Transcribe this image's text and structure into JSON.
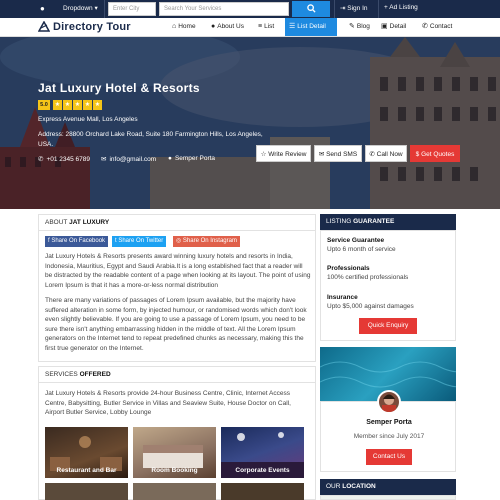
{
  "topbar": {
    "dropdown_label": "Dropdown",
    "city_placeholder": "Enter City",
    "search_placeholder": "Search Your Services",
    "sign_in": "Sign In",
    "ad_listing": "Ad Listing"
  },
  "nav": {
    "logo": "Directory Tour",
    "items": [
      {
        "icon": "home-icon",
        "label": "Home"
      },
      {
        "icon": "user-icon",
        "label": "About Us"
      },
      {
        "icon": "list-icon",
        "label": "List"
      },
      {
        "icon": "list-detail-icon",
        "label": "List Detail"
      },
      {
        "icon": "blog-icon",
        "label": "Blog"
      },
      {
        "icon": "detail-icon",
        "label": "Detail"
      },
      {
        "icon": "phone-icon",
        "label": "Contact"
      }
    ],
    "active_index": 3
  },
  "hero": {
    "title": "Jat Luxury Hotel & Resorts",
    "rating": "5.0",
    "stars": 5,
    "subtitle": "Express Avenue Mall, Los Angeles",
    "address": "Address: 28800 Orchard Lake Road, Suite 180 Farmington Hills, Los Angeles, USA.",
    "phone": "+01 2345 6789",
    "email": "info@gmail.com",
    "person": "Semper Porta",
    "buttons": [
      "Write Review",
      "Send SMS",
      "Call Now",
      "Get Quotes"
    ]
  },
  "about": {
    "head_prefix": "ABOUT",
    "head_name": "JAT LUXURY",
    "share": [
      "Share On Facebook",
      "Share On Twitter",
      "Share On Instagram"
    ],
    "para1": "Jat Luxury Hotels & Resorts presents award winning luxury hotels and resorts in India, Indonesia, Mauritius, Egypt and Saudi Arabia.It is a long established fact that a reader will be distracted by the readable content of a page when looking at its layout. The point of using Lorem Ipsum is that it has a more-or-less normal distribution",
    "para2": "There are many variations of passages of Lorem Ipsum available, but the majority have suffered alteration in some form, by injected humour, or randomised words which don't look even slightly believable. If you are going to use a passage of Lorem Ipsum, you need to be sure there isn't anything embarrassing hidden in the middle of text. All the Lorem Ipsum generators on the Internet tend to repeat predefined chunks as necessary, making this the first true generator on the Internet."
  },
  "services": {
    "head_prefix": "SERVICES",
    "head_name": "OFFERED",
    "desc": "Jat Luxury Hotels & Resorts provide 24-hour Business Centre, Clinic, Internet Access Centre, Babysitting, Butler Service in Villas and Seaview Suite, House Doctor on Call, Airport Butler Service, Lobby Lounge",
    "items": [
      "Restaurant and Bar",
      "Room Booking",
      "Corporate Events"
    ]
  },
  "guarantee": {
    "head_prefix": "LISTING",
    "head_name": "GUARANTEE",
    "items": [
      {
        "title": "Service Guarantee",
        "desc": "Upto 6 month of service"
      },
      {
        "title": "Professionals",
        "desc": "100% certified professionals"
      },
      {
        "title": "Insurance",
        "desc": "Upto $5,000 against damages"
      }
    ],
    "button": "Quick Enquiry"
  },
  "owner": {
    "name": "Semper Porta",
    "since": "Member since July 2017",
    "button": "Contact Us"
  },
  "location": {
    "head_prefix": "OUR",
    "head_name": "LOCATION"
  },
  "colors": {
    "navy": "#1a2a4a",
    "blue": "#1e8ae0",
    "red": "#e53935",
    "gold": "#f5c518"
  }
}
